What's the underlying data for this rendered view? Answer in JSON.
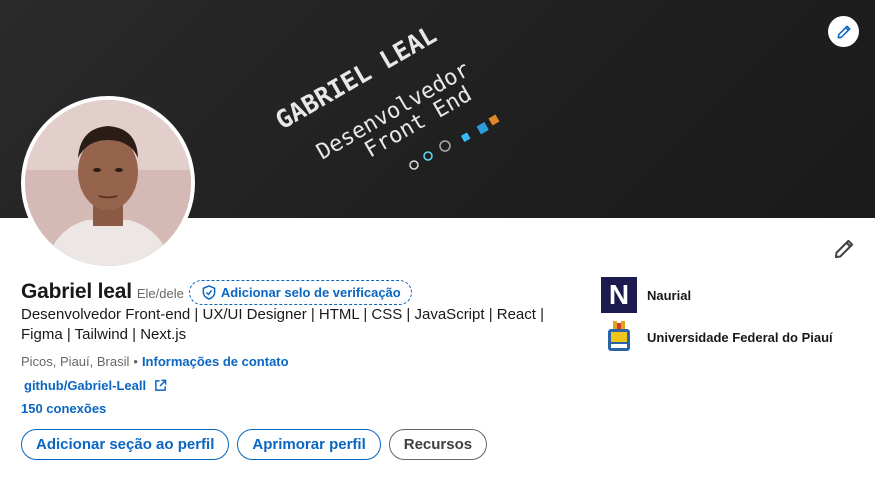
{
  "banner": {
    "line1": "GABRIEL LEAL",
    "line2": "Desenvolvedor",
    "line3": "Front End"
  },
  "profile": {
    "name": "Gabriel leal",
    "pronouns": "Ele/dele",
    "verify_label": "Adicionar selo de verificação",
    "headline": "Desenvolvedor Front-end | UX/UI Designer | HTML | CSS | JavaScript | React | Figma | Tailwind | Next.js",
    "location": "Picos, Piauí, Brasil",
    "separator": "•",
    "contact_label": "Informações de contato",
    "website": "github/Gabriel-Leall",
    "connections": "150 conexões"
  },
  "actions": {
    "add_section": "Adicionar seção ao perfil",
    "enhance": "Aprimorar perfil",
    "resources": "Recursos"
  },
  "experience": [
    {
      "name": "Naurial",
      "logo_letter": "N"
    },
    {
      "name": "Universidade Federal do Piauí"
    }
  ],
  "colors": {
    "link_blue": "#0a66c2",
    "banner_dark": "#202020",
    "naurial_navy": "#1d1a4f"
  },
  "icons": [
    "pencil-icon",
    "shield-check-icon",
    "external-link-icon"
  ]
}
